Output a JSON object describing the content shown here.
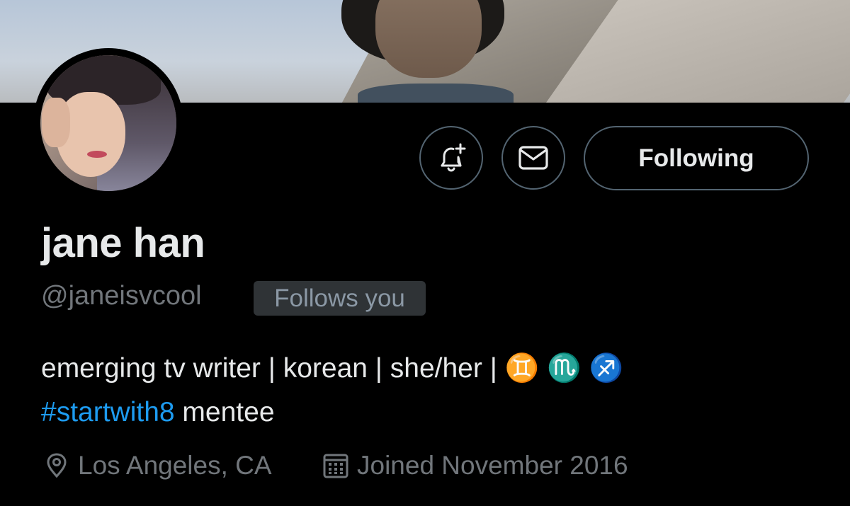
{
  "profile": {
    "display_name": "jane han",
    "handle": "@janeisvcool",
    "follows_you_badge": "Follows you",
    "bio_line1": "emerging tv writer | korean | she/her | ♊ ♏ ♐",
    "bio_hashtag": "#startwith8",
    "bio_line2_rest": " mentee",
    "location": "Los Angeles, CA",
    "joined": "Joined November 2016"
  },
  "actions": {
    "notify_icon": "bell-plus-icon",
    "message_icon": "envelope-icon",
    "following_label": "Following"
  },
  "colors": {
    "background": "#000000",
    "link": "#1d9bf0",
    "muted": "#71767b",
    "border": "#536471"
  }
}
